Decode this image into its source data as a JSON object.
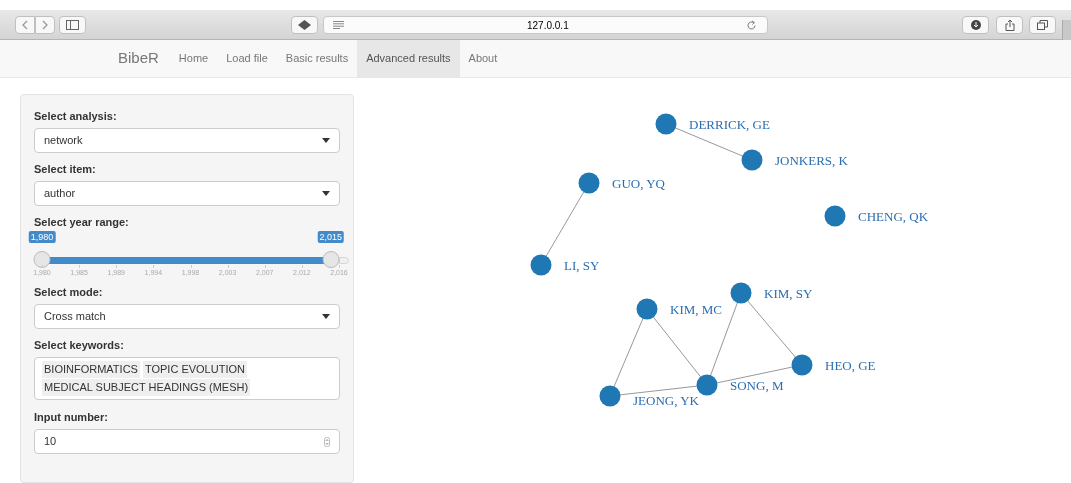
{
  "browser": {
    "url": "127.0.0.1"
  },
  "navbar": {
    "brand": "BibeR",
    "tabs": [
      {
        "label": "Home",
        "selected": false
      },
      {
        "label": "Load file",
        "selected": false
      },
      {
        "label": "Basic results",
        "selected": false
      },
      {
        "label": "Advanced results",
        "selected": true
      },
      {
        "label": "About",
        "selected": false
      }
    ]
  },
  "sidebar": {
    "analysis": {
      "label": "Select analysis:",
      "value": "network"
    },
    "item": {
      "label": "Select item:",
      "value": "author"
    },
    "year_range": {
      "label": "Select year range:",
      "low": {
        "label": "1,980",
        "level": 0
      },
      "high": {
        "label": "2,015",
        "level": 0.972
      },
      "ticks": [
        "1,980",
        "1,985",
        "1,989",
        "1,994",
        "1,998",
        "2,003",
        "2,007",
        "2,012",
        "2,016"
      ]
    },
    "mode": {
      "label": "Select mode:",
      "value": "Cross match"
    },
    "keywords": {
      "label": "Select keywords:",
      "tags": [
        "BIOINFORMATICS",
        "TOPIC EVOLUTION",
        "MEDICAL SUBJECT HEADINGS (MESH)"
      ]
    },
    "number": {
      "label": "Input number:",
      "value": "10"
    }
  },
  "network": {
    "nodes": [
      "DERRICK, GE",
      "JONKERS, K",
      "GUO, YQ",
      "CHENG, QK",
      "LI, SY",
      "KIM, SY",
      "KIM, MC",
      "HEO, GE",
      "SONG, M",
      "JEONG, YK"
    ]
  }
}
